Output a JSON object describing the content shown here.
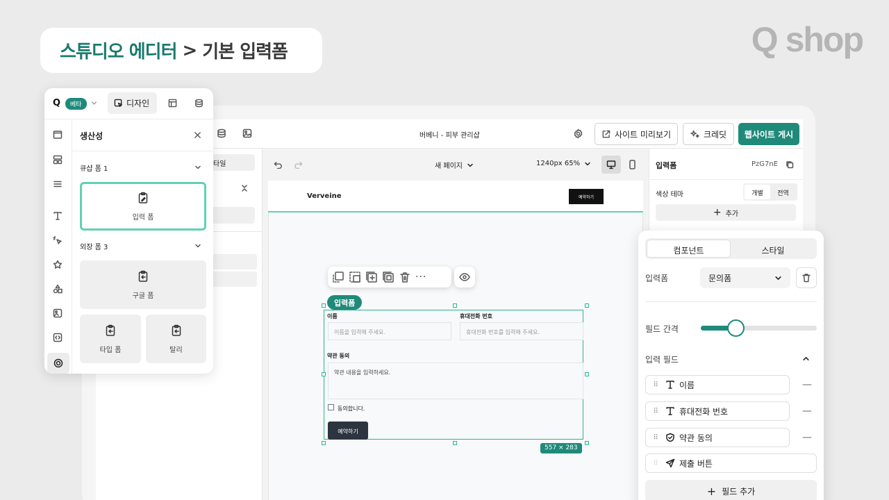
{
  "breadcrumb": {
    "part1": "스튜디오 에디터",
    "separator": ">",
    "part2": "기본 입력폼"
  },
  "logo": "Q shop",
  "topbar": {
    "site_name": "버베니 - 피부 관리샵",
    "preview_label": "사이트 미리보기",
    "credit_label": "크레딧",
    "publish_label": "웹사이트 게시"
  },
  "left_panel": {
    "beta_badge": "베타",
    "design_tab": "디자인",
    "section_title": "생산성",
    "group1": "큐샵 폼 1",
    "form_card": "입력 폼",
    "group2": "외장 폼 3",
    "google_form": "구글 폼",
    "typeform": "타입 폼",
    "tally": "탈리"
  },
  "leftcol": {
    "style_tab": "타일"
  },
  "canvas_bar": {
    "page_name": "새 페이지",
    "viewport": "1240px 65%"
  },
  "preview": {
    "brand": "Verveine",
    "header_button": "예약하기",
    "form_badge": "입력폼",
    "name_label": "이름",
    "name_placeholder": "이름을 입력해 주세요.",
    "phone_label": "휴대전화 번호",
    "phone_placeholder": "휴대전화 번호를 입력해 주세요.",
    "terms_label": "약관 동의",
    "terms_placeholder": "약관 내용을 입력하세요.",
    "agree_label": "동의합니다.",
    "submit_label": "예약하기",
    "size_badge": "557 × 283"
  },
  "rightcol": {
    "title": "입력폼",
    "element_id": "PzG7nE",
    "color_theme_label": "색상 테마",
    "seg_individual": "개별",
    "seg_global": "전역",
    "add_label": "추가"
  },
  "right_panel": {
    "tab_component": "컴포넌트",
    "tab_style": "스타일",
    "form_label": "입력폼",
    "form_select_value": "문의폼",
    "field_spacing_label": "필드 간격",
    "field_spacing_value": 0.3,
    "input_fields_label": "입력 필드",
    "fields": [
      {
        "label": "이름"
      },
      {
        "label": "휴대전화 번호"
      },
      {
        "label": "약관 동의"
      },
      {
        "label": "제출 버튼"
      }
    ],
    "add_field_label": "필드 추가"
  },
  "colors": {
    "accent": "#1f8a7a",
    "highlight": "#5fd2b2",
    "dark_button": "#2c3440"
  }
}
